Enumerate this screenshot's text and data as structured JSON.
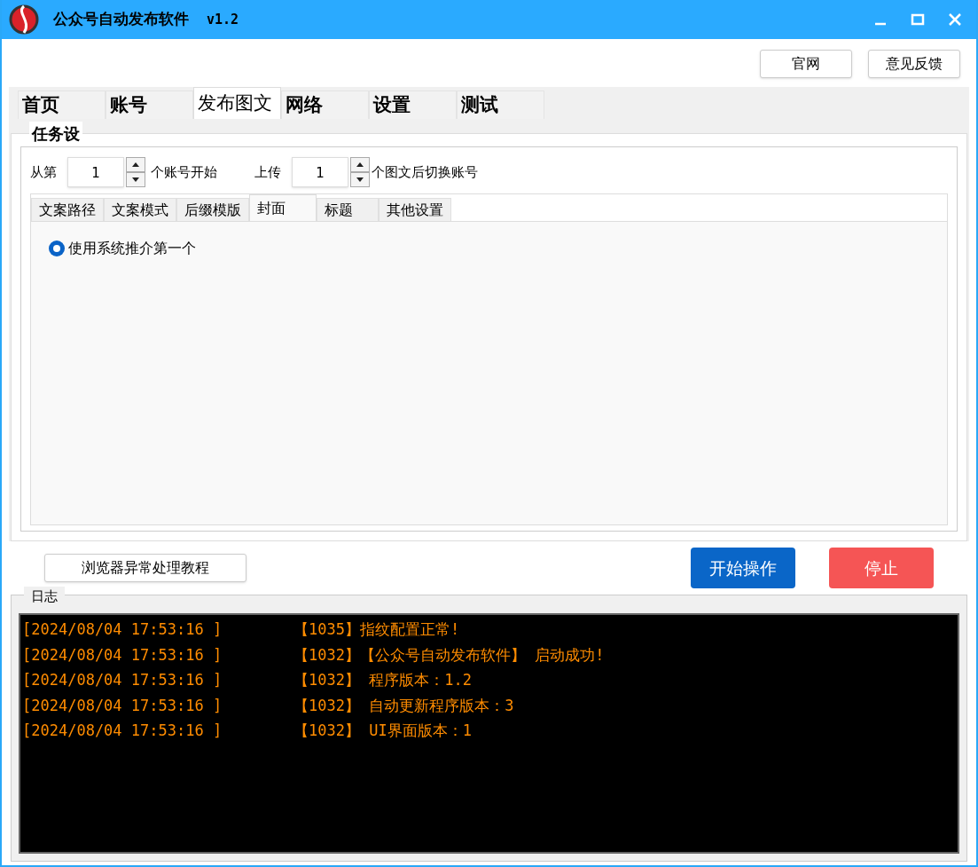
{
  "window": {
    "title": "公众号自动发布软件",
    "version": "v1.2"
  },
  "top_buttons": [
    "官网",
    "意见反馈"
  ],
  "tabs": [
    {
      "label": "首页",
      "selected": false
    },
    {
      "label": "账号",
      "selected": false
    },
    {
      "label": "发布图文",
      "selected": true
    },
    {
      "label": "网络",
      "selected": false
    },
    {
      "label": "设置",
      "selected": false
    },
    {
      "label": "测试",
      "selected": false
    }
  ],
  "task_group": {
    "title": "任务设",
    "start_label": "从第",
    "start_value": "1",
    "start_suffix": "个账号开始",
    "upload_label": "上传",
    "upload_value": "1",
    "upload_suffix": "个图文后切换账号"
  },
  "sub_tabs": [
    {
      "label": "文案路径",
      "selected": false
    },
    {
      "label": "文案模式",
      "selected": false
    },
    {
      "label": "后缀模版",
      "selected": false
    },
    {
      "label": "封面",
      "selected": true
    },
    {
      "label": "标题",
      "selected": false
    },
    {
      "label": "其他设置",
      "selected": false
    }
  ],
  "cover_options": [
    {
      "label": "使用系统推介第一个",
      "selected": true
    }
  ],
  "tutorial_button": "浏览器异常处理教程",
  "start_button": "开始操作",
  "stop_button": "停止",
  "log": {
    "title": "日志",
    "lines": [
      {
        "time": "[2024/08/04 17:53:16 ]",
        "message": "【1035】指纹配置正常!"
      },
      {
        "time": "[2024/08/04 17:53:16 ]",
        "message": "【1032】【公众号自动发布软件】 启动成功!"
      },
      {
        "time": "[2024/08/04 17:53:16 ]",
        "message": "【1032】 程序版本：1.2"
      },
      {
        "time": "[2024/08/04 17:53:16 ]",
        "message": "【1032】 自动更新程序版本：3"
      },
      {
        "time": "[2024/08/04 17:53:16 ]",
        "message": "【1032】 UI界面版本：1"
      }
    ]
  }
}
